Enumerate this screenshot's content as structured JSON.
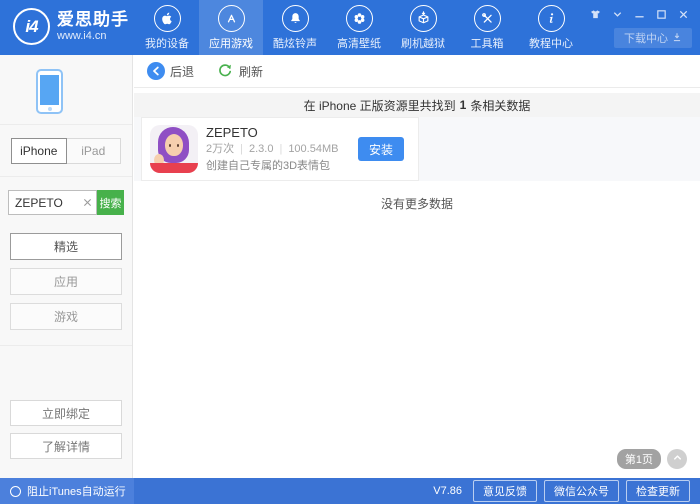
{
  "colors": {
    "header_blue": "#2e72d9",
    "accent_blue": "#3e8cf0",
    "search_green": "#47b14b",
    "statusbar_blue": "#3b73d4"
  },
  "header": {
    "logo": {
      "mark": "i4",
      "title": "爱思助手",
      "subtitle": "www.i4.cn"
    },
    "nav": [
      {
        "label": "我的设备",
        "icon": "apple-icon",
        "active": false
      },
      {
        "label": "应用游戏",
        "icon": "appstore-icon",
        "active": true
      },
      {
        "label": "酷炫铃声",
        "icon": "bell-icon",
        "active": false
      },
      {
        "label": "高清壁纸",
        "icon": "flower-icon",
        "active": false
      },
      {
        "label": "刷机越狱",
        "icon": "box-icon",
        "active": false
      },
      {
        "label": "工具箱",
        "icon": "tools-icon",
        "active": false
      },
      {
        "label": "教程中心",
        "icon": "info-icon",
        "active": false
      }
    ],
    "download_center_label": "下载中心"
  },
  "sidebar": {
    "device_tabs": [
      {
        "label": "iPhone",
        "active": true
      },
      {
        "label": "iPad",
        "active": false
      }
    ],
    "search": {
      "value": "ZEPETO",
      "button_label": "搜索"
    },
    "categories": [
      {
        "label": "精选",
        "active": true
      },
      {
        "label": "应用",
        "active": false
      },
      {
        "label": "游戏",
        "active": false
      }
    ],
    "bind_button_label": "立即绑定",
    "details_button_label": "了解详情"
  },
  "toolbar": {
    "back_label": "后退",
    "refresh_label": "刷新"
  },
  "content": {
    "result_banner": {
      "prefix": "在 iPhone 正版资源里共找到",
      "count": "1",
      "suffix": "条相关数据"
    },
    "app": {
      "name": "ZEPETO",
      "downloads": "2万次",
      "version": "2.3.0",
      "size": "100.54MB",
      "separator": "|",
      "description": "创建自己专属的3D表情包",
      "install_label": "安装"
    },
    "empty_text": "没有更多数据",
    "page_badge": "第1页"
  },
  "statusbar": {
    "itunes_toggle_label": "阻止iTunes自动运行",
    "version": "V7.86",
    "buttons": [
      {
        "label": "意见反馈"
      },
      {
        "label": "微信公众号"
      },
      {
        "label": "检查更新"
      }
    ]
  }
}
